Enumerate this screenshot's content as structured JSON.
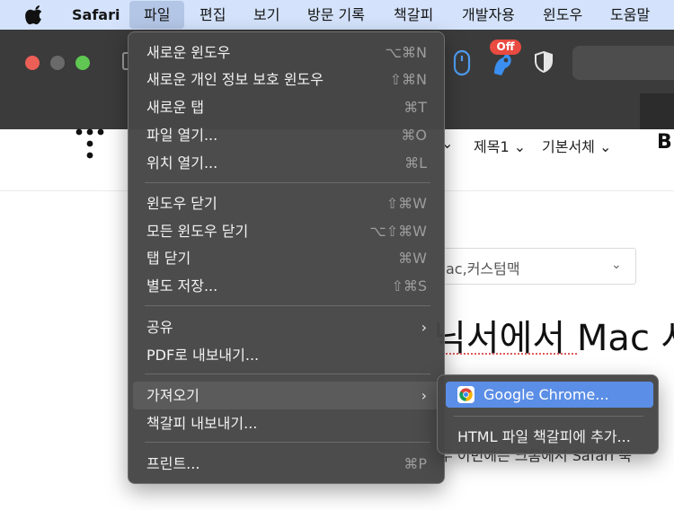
{
  "menubar": {
    "app": "Safari",
    "items": [
      "파일",
      "편집",
      "보기",
      "방문 기록",
      "책갈피",
      "개발자용",
      "윈도우",
      "도움말"
    ]
  },
  "toolbar": {
    "extension_badge": "Off"
  },
  "page": {
    "format_heading": "제목1",
    "format_font": "기본서체",
    "format_bold": "B",
    "select_value": "ac,커스텀맥",
    "title": "닉서에서 Mac 사",
    "body_snippet": "무 이번에는 크롬에서 Safari 북"
  },
  "file_menu": {
    "items": [
      {
        "label": "새로운 윈도우",
        "shortcut": "⌥⌘N"
      },
      {
        "label": "새로운 개인 정보 보호 윈도우",
        "shortcut": "⇧⌘N"
      },
      {
        "label": "새로운 탭",
        "shortcut": "⌘T"
      },
      {
        "label": "파일 열기...",
        "shortcut": "⌘O"
      },
      {
        "label": "위치 열기...",
        "shortcut": "⌘L"
      },
      {
        "label": "윈도우 닫기",
        "shortcut": "⇧⌘W"
      },
      {
        "label": "모든 윈도우 닫기",
        "shortcut": "⌥⇧⌘W"
      },
      {
        "label": "탭 닫기",
        "shortcut": "⌘W"
      },
      {
        "label": "별도 저장...",
        "shortcut": "⇧⌘S"
      },
      {
        "label": "공유",
        "shortcut": ""
      },
      {
        "label": "PDF로 내보내기...",
        "shortcut": ""
      },
      {
        "label": "가져오기",
        "shortcut": ""
      },
      {
        "label": "책갈피 내보내기...",
        "shortcut": ""
      },
      {
        "label": "프린트...",
        "shortcut": "⌘P"
      }
    ]
  },
  "import_submenu": {
    "items": [
      {
        "label": "Google Chrome..."
      },
      {
        "label": "HTML 파일 책갈피에 추가..."
      }
    ]
  },
  "colors": {
    "menubar_bg": "#d4e3fb",
    "menu_bg": "#464646",
    "selection": "#5b8ee6",
    "badge": "#e94b40"
  }
}
